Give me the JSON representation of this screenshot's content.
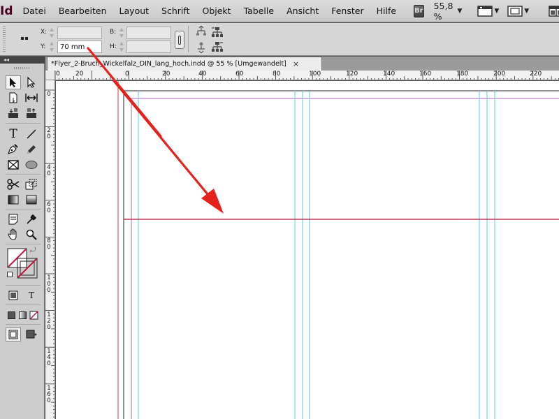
{
  "app": {
    "logo": "Id"
  },
  "menu": [
    "Datei",
    "Bearbeiten",
    "Layout",
    "Schrift",
    "Objekt",
    "Tabelle",
    "Ansicht",
    "Fenster",
    "Hilfe"
  ],
  "bridge_badge": "Br",
  "zoom": {
    "value": "55,8 %"
  },
  "control": {
    "x_label": "X:",
    "y_label": "Y:",
    "w_label": "B:",
    "h_label": "H:",
    "x_value": "",
    "y_value": "70 mm",
    "w_value": "",
    "h_value": ""
  },
  "tab": {
    "title": "*Flyer_2-Bruch_Wickelfalz_DIN_lang_hoch.indd @ 55 % [Umgewandelt]",
    "close": "×"
  },
  "tool_panel_header": "◂◂",
  "ruler_h": [
    "0",
    "20",
    "0",
    "20",
    "40",
    "60",
    "80",
    "100",
    "120",
    "140",
    "160",
    "180",
    "200",
    "220"
  ],
  "ruler_v": [
    [
      "0"
    ],
    [
      "2",
      "0"
    ],
    [
      "4",
      "0"
    ],
    [
      "6",
      "0"
    ],
    [
      "8",
      "0"
    ],
    [
      "1",
      "0",
      "0"
    ],
    [
      "1",
      "2",
      "0"
    ],
    [
      "1",
      "4",
      "0"
    ],
    [
      "1",
      "6",
      "0"
    ]
  ],
  "colors": {
    "arrow": "#e4211d",
    "guide_cyan": "#4fd2d8",
    "guide_magenta": "#b061b6",
    "guide_red": "#d13b3b",
    "accent": "#49021f"
  }
}
